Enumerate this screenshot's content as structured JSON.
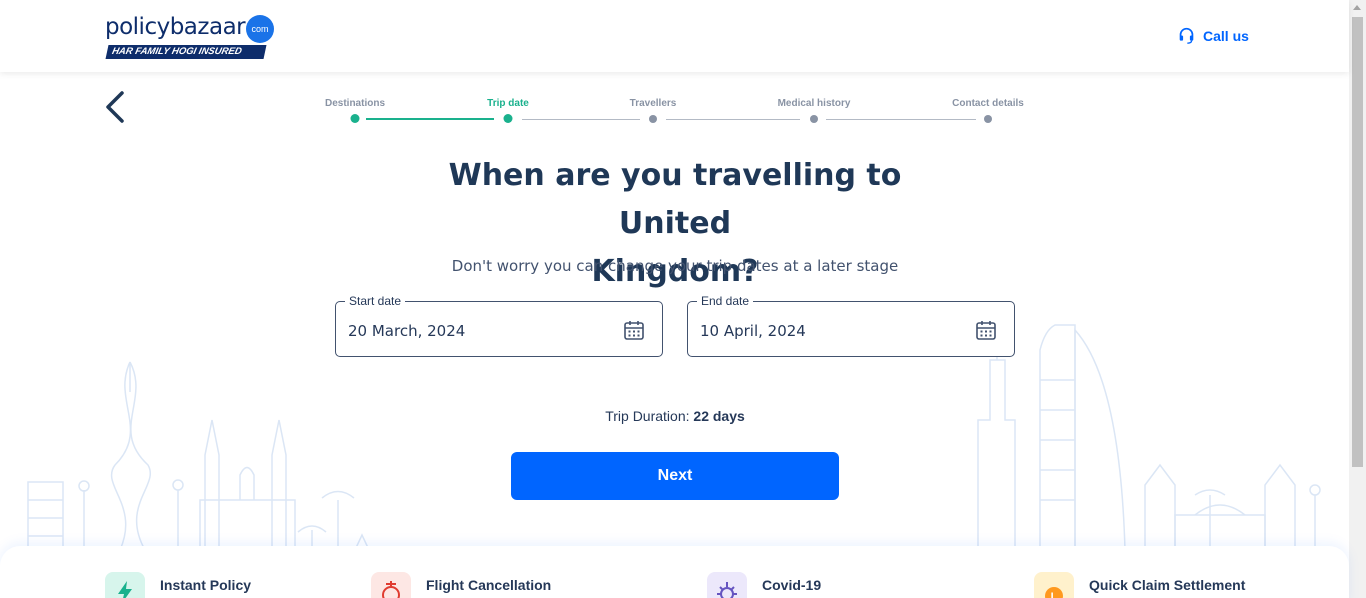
{
  "header": {
    "logo": {
      "brand_text": "policybazaar",
      "badge": "com",
      "tagline": "HAR FAMILY HOGI INSURED"
    },
    "call_label": "Call us"
  },
  "stepper": {
    "steps": [
      {
        "label": "Destinations",
        "state": "done"
      },
      {
        "label": "Trip date",
        "state": "active"
      },
      {
        "label": "Travellers",
        "state": "pending"
      },
      {
        "label": "Medical history",
        "state": "pending"
      },
      {
        "label": "Contact details",
        "state": "pending"
      }
    ]
  },
  "main": {
    "title_line1": "When are you travelling to United",
    "title_line2": "Kingdom?",
    "subtitle": "Don't worry you can change your trip dates at a later stage",
    "start_date": {
      "label": "Start date",
      "value": "20 March, 2024"
    },
    "end_date": {
      "label": "End date",
      "value": "10 April, 2024"
    },
    "duration_label": "Trip Duration:",
    "duration_value": "22 days",
    "next_label": "Next"
  },
  "features": [
    {
      "label": "Instant Policy",
      "icon": "lightning-icon"
    },
    {
      "label": "Flight Cancellation",
      "icon": "flight-cancel-icon"
    },
    {
      "label": "Covid-19",
      "icon": "virus-icon"
    },
    {
      "label": "Quick Claim Settlement",
      "icon": "coin-icon"
    }
  ],
  "colors": {
    "primary": "#0065ff",
    "success": "#1ab18d",
    "heading": "#1f3857",
    "muted": "#8993a4"
  }
}
